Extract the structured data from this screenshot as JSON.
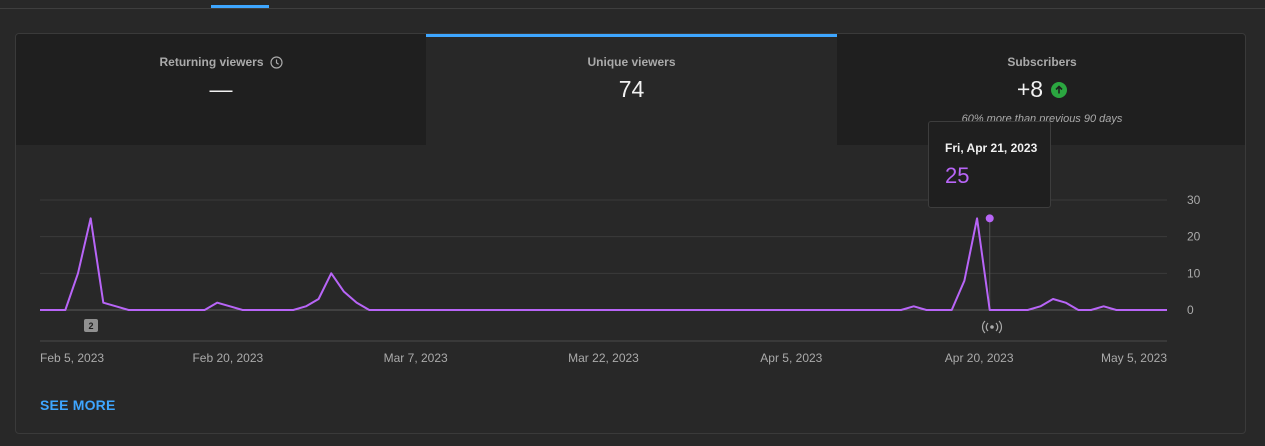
{
  "metrics": [
    {
      "label": "Returning viewers",
      "value": "—",
      "sub": "",
      "icon": "clock-icon"
    },
    {
      "label": "Unique viewers",
      "value": "74",
      "sub": "",
      "active": true
    },
    {
      "label": "Subscribers",
      "value": "+8",
      "sub": "60% more than previous 90 days",
      "icon": "arrow-up-circle-icon"
    }
  ],
  "tooltip": {
    "date": "Fri, Apr 21, 2023",
    "value": "25"
  },
  "see_more_label": "SEE MORE",
  "marker_badge": "2",
  "colors": {
    "line": "#b865f7",
    "accent": "#3ea6ff",
    "positive": "#2ba640"
  },
  "chart_data": {
    "type": "line",
    "x_tick_labels": [
      "Feb 5, 2023",
      "Feb 20, 2023",
      "Mar 7, 2023",
      "Mar 22, 2023",
      "Apr 5, 2023",
      "Apr 20, 2023",
      "May 5, 2023"
    ],
    "y_tick_labels": [
      "30",
      "20",
      "10",
      "0"
    ],
    "ylim": [
      0,
      30
    ],
    "grid": true,
    "x_start": "2023-02-05",
    "x_end": "2023-05-05",
    "highlight": {
      "date": "2023-04-21",
      "value": 25
    },
    "series": [
      {
        "points": [
          [
            "2023-02-05",
            0
          ],
          [
            "2023-02-06",
            0
          ],
          [
            "2023-02-07",
            0
          ],
          [
            "2023-02-08",
            10
          ],
          [
            "2023-02-09",
            25
          ],
          [
            "2023-02-10",
            2
          ],
          [
            "2023-02-11",
            1
          ],
          [
            "2023-02-12",
            0
          ],
          [
            "2023-02-18",
            0
          ],
          [
            "2023-02-19",
            2
          ],
          [
            "2023-02-20",
            1
          ],
          [
            "2023-02-21",
            0
          ],
          [
            "2023-02-25",
            0
          ],
          [
            "2023-02-26",
            1
          ],
          [
            "2023-02-27",
            3
          ],
          [
            "2023-02-28",
            10
          ],
          [
            "2023-03-01",
            5
          ],
          [
            "2023-03-02",
            2
          ],
          [
            "2023-03-03",
            0
          ],
          [
            "2023-04-14",
            0
          ],
          [
            "2023-04-15",
            1
          ],
          [
            "2023-04-16",
            0
          ],
          [
            "2023-04-18",
            0
          ],
          [
            "2023-04-19",
            8
          ],
          [
            "2023-04-20",
            25
          ],
          [
            "2023-04-21",
            0
          ],
          [
            "2023-04-24",
            0
          ],
          [
            "2023-04-25",
            1
          ],
          [
            "2023-04-26",
            3
          ],
          [
            "2023-04-27",
            2
          ],
          [
            "2023-04-28",
            0
          ],
          [
            "2023-04-29",
            0
          ],
          [
            "2023-04-30",
            1
          ],
          [
            "2023-05-01",
            0
          ],
          [
            "2023-05-05",
            0
          ]
        ]
      }
    ]
  }
}
